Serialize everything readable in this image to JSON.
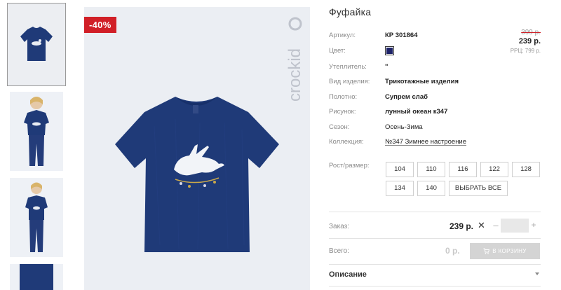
{
  "product": {
    "title": "Фуфайка",
    "discount_badge": "-40%",
    "brand": "crockid"
  },
  "attributes": [
    {
      "label": "Артикул:",
      "value": "КР 301864"
    },
    {
      "label": "Цвет:",
      "value": ""
    },
    {
      "label": "Утеплитель:",
      "value": "\""
    },
    {
      "label": "Вид изделия:",
      "value": "Трикотажные изделия"
    },
    {
      "label": "Полотно:",
      "value": "Супрем слаб"
    },
    {
      "label": "Рисунок:",
      "value": "лунный океан к347"
    },
    {
      "label": "Сезон:",
      "value": "Осень-Зима"
    },
    {
      "label": "Коллекция:",
      "value": "№347 Зимнее настроение"
    }
  ],
  "colors": {
    "swatch": "#1e2368",
    "accent_red": "#d11f27",
    "shirt": "#1f3a78"
  },
  "pricing": {
    "old_price": "399 р.",
    "price": "239 р.",
    "rrc": "РРЦ: 799 р."
  },
  "sizes": {
    "label": "Рост/размер:",
    "options": [
      "104",
      "110",
      "116",
      "122",
      "128",
      "134",
      "140"
    ],
    "select_all": "ВЫБРАТЬ ВСЕ"
  },
  "order": {
    "label": "Заказ:",
    "price": "239 р.",
    "times": "✕",
    "minus": "–",
    "plus": "+",
    "quantity": ""
  },
  "total": {
    "label": "Всего:",
    "value": "0 р.",
    "cart_button": "В КОРЗИНУ"
  },
  "description": {
    "label": "Описание"
  },
  "icons": {
    "cart": "cart-icon",
    "dropdown": "chevron-down-icon"
  }
}
